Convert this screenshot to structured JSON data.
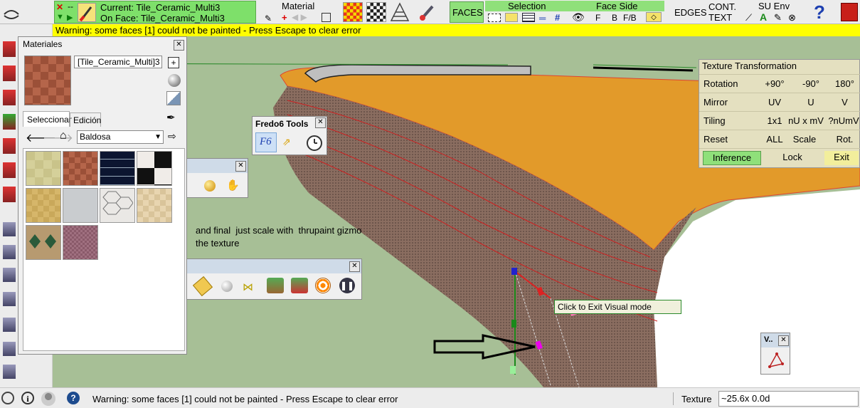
{
  "top_toolbar": {
    "current_label": "Current: Tile_Ceramic_Multi3",
    "on_face_label": "On Face: Tile_Ceramic_Multi3",
    "material_title": "Material",
    "faces_label": "FACES",
    "selection_title": "Selection",
    "face_side_title": "Face Side",
    "face_side_options": [
      "F",
      "B",
      "F/B"
    ],
    "edges_label": "EDGES",
    "cont_label": "CONT.",
    "text_label": "TEXT",
    "suenv_title": "SU Env",
    "help_label": "?",
    "dash_label": "--"
  },
  "warning_bar": {
    "text": "Warning: some faces [1] could not be painted - Press Escape to clear error"
  },
  "materials_panel": {
    "title": "Materiales",
    "material_name": "[Tile_Ceramic_Multi]3",
    "tabs": [
      "Seleccionar",
      "Edición"
    ],
    "library_select": "Baldosa"
  },
  "fredo_panel": {
    "title": "Fredo6 Tools",
    "f6_label": "F6"
  },
  "texture_transformation": {
    "title": "Texture Transformation",
    "rows": [
      {
        "label": "Rotation",
        "options": [
          "+90°",
          "-90°",
          "180°"
        ]
      },
      {
        "label": "Mirror",
        "options": [
          "UV",
          "U",
          "V"
        ]
      },
      {
        "label": "Tiling",
        "options": [
          "1x1",
          "nU x mV",
          "?nUmV"
        ]
      },
      {
        "label": "Reset",
        "options": [
          "ALL",
          "Scale",
          "Rot."
        ]
      }
    ],
    "inference_label": "Inference",
    "lock_label": "Lock",
    "exit_label": "Exit"
  },
  "viewport": {
    "annotation_line1": "and final  just scale with  thrupaint gizmo",
    "annotation_line2": "the texture",
    "tooltip": "Click to Exit Visual mode",
    "small_panel_title": "V.."
  },
  "status_bar": {
    "message": "Warning: some faces [1] could not be painted - Press Escape to clear error",
    "measure_label": "Texture",
    "measure_value": "~25.6x 0.0d"
  },
  "colors": {
    "current_green": "#7ee06a",
    "warning_yellow": "#ffff00",
    "viewport_green": "#a7bf96",
    "texture_panel_bg": "#e4e0c0",
    "inference_green": "#8fe07a",
    "exit_yellow": "#f2ee9c",
    "wall_orange": "#e29a2a"
  }
}
